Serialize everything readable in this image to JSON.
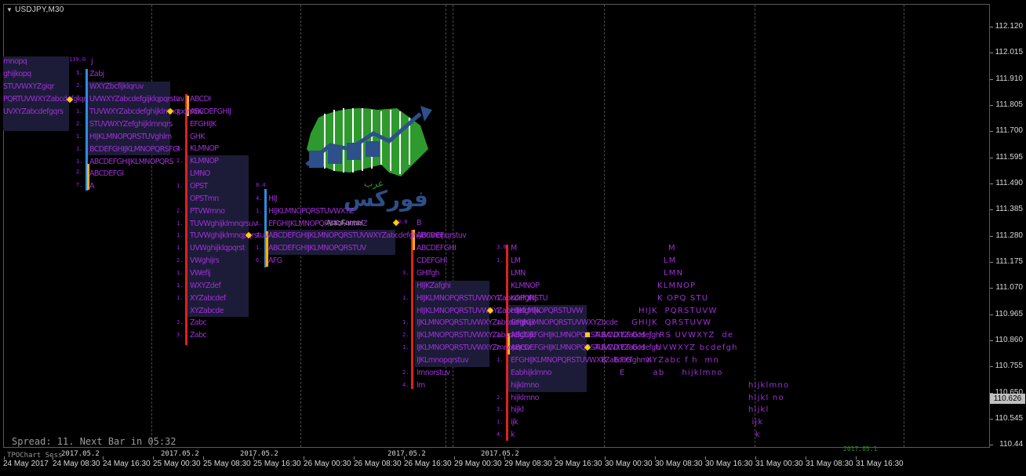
{
  "chart": {
    "symbol_label": "USDJPY,M30",
    "spread_text": "Spread: 11. Next Bar in 05:32",
    "tpo_label": "TPOChart Sess",
    "current_price": "110.626",
    "bottom_stamp": "2017.05.1",
    "watermark_text": "ArabFunnel"
  },
  "y_axis": [
    "112.120",
    "112.015",
    "111.910",
    "111.805",
    "111.700",
    "111.595",
    "111.490",
    "111.385",
    "111.280",
    "111.175",
    "111.070",
    "110.965",
    "110.860",
    "110.755",
    "110.650",
    "110.545",
    "110.44"
  ],
  "x_axis": [
    "24 May 2017",
    "24 May 08:30",
    "24 May 16:30",
    "25 May 00:30",
    "25 May 08:30",
    "25 May 16:30",
    "26 May 00:30",
    "26 May 08:30",
    "26 May 16:30",
    "29 May 00:30",
    "29 May 08:30",
    "29 May 16:30",
    "30 May 00:30",
    "30 May 08:30",
    "30 May 16:30",
    "31 May 00:30",
    "31 May 08:30",
    "31 May 16:30"
  ],
  "date_overlays": [
    "2017.05.2",
    "2017.05.2",
    "2017.05.2",
    "2017.05.2",
    "2017.05.2"
  ],
  "profiles": {
    "p1": {
      "rows": [
        "mnopq",
        "ghijkopq",
        "STUVWXYZgiqr",
        "PQRTUVWXYZabcdefgiqr",
        "UVXYZabcdefgqrs"
      ],
      "nums": [
        "139.0",
        "1.",
        "2.",
        "2.",
        "1."
      ]
    },
    "p2": {
      "rows": [
        "j",
        "Zabj",
        "WXYZbcfijklqruv",
        "UVWXYZabcdefgijklqpqrstuv",
        "TUVWXYZabcdefghijklmnqpqrstuv",
        "STUVWXYZefghijklmnqrs",
        "HIJKLMNOPQRSTUVghlm",
        "BCDEFGHIJKLMNOPQRSFGI",
        "ABCDEFGHIJKLMNOPQRS",
        "ABCDEFGI",
        "A"
      ],
      "nums": [
        "1.",
        "2.",
        "1.",
        "1.",
        "1.",
        "2.",
        "7."
      ]
    },
    "p3": {
      "rows": [
        "ABCDI",
        "ABCDEFGHIJ",
        "EFGHIJK",
        "GHK",
        "KLMNOP",
        "KLMNOP",
        "LMNO",
        "OPST",
        "OPSTmn",
        "PTVWmno",
        "TUVWghijklmnqrsuv",
        "TUVWghijklmnqpqrstuv",
        "UVWghijklqpqrst",
        "VWghijrs",
        "VWefij",
        "WXYZdef",
        "XYZabcdef",
        "XYZabcde",
        "Zabc",
        "Zabc"
      ],
      "nums": [
        "2.",
        "1.",
        "1.",
        "2.",
        "1.",
        "2.",
        "1.",
        "1.",
        "1.",
        "2.",
        "1.",
        "1.",
        "1.",
        "3.",
        "3."
      ]
    },
    "p4": {
      "rows": [
        "HIJ",
        "HIJKLMNOPQRSTUVWXYZ",
        "EFGHIJKLMNOPQRSTUVWXYZ",
        "ABCDEFGHIJKLMNOPQRSTUVWXYZabcdefghijklmnopqrstuv",
        "ABCDEFGHIJKLMNOPQRSTUV",
        "AFG"
      ],
      "nums": [
        "8.4",
        "4.",
        "1.",
        "1.",
        "1.",
        "1.",
        "6."
      ]
    },
    "p5": {
      "rows": [
        "B",
        "ABCDEF",
        "ABCDEFGHI",
        "CDEFGHI",
        "GHIfgh",
        "HIJKZafghi",
        "HIJKLMNOPQRSTUVWXYZabcdefghij",
        "HIJKLMNOPQRSTUVWXYZabcdefghijk",
        "IJKLMNOPQRSTUVWXYZabcdefghijk",
        "IJKLMNOPQRSTUVWXYZabcdefghijk",
        "IJKLMNOPQRSTUVWXYZmnopqrsv",
        "IJKLmnopqrstuv",
        "lmnorstuv",
        "lm"
      ],
      "nums": [
        "9.0",
        "3.",
        "1.",
        "1.",
        "2.",
        "1.",
        "2.",
        "4."
      ]
    },
    "p6": {
      "rows": [
        "M",
        "LM",
        "LMN",
        "KLMNOP",
        "KOPQRSTU",
        "HIJKLMNOPQRSTUVW",
        "GHIJKLMNOPQRSTUVWXYZbcde",
        "ABCDEFGHIJKLMNOPQRSTUVWXYZabcdefgh",
        "ABCDEFGHIJKLMNOPQRSTUVWXYZabcdefgh",
        "EFGHIJKLMNOPQRSTUVWXYZabcdefghmn",
        "Eabhijklmno",
        "hijklmno",
        "hijklmno",
        "hijkl",
        "ijk",
        "k"
      ],
      "nums": [
        "3.0",
        "1.",
        "1.",
        "1.",
        "1.",
        "1.",
        "2.",
        "1.",
        "2.",
        "3.",
        "1.",
        "4."
      ]
    },
    "p7": {
      "rows": [
        "M",
        "LM",
        "LMN",
        "KLMNOP",
        "K OPQ STU",
        "HIJK  PQRSTUVW",
        "GHIJK  QRSTUVW",
        "ABCDEFGH J  RS UVWXYZ  de",
        "ABCDEFGH   UVWXYZ bcdefgh",
        "B  EFG    XYZabc f h  mn",
        "E        ab     hijklmno",
        "                hijklmno",
        "                hijkl no",
        "                hijkl",
        "                 ijk",
        "                  k"
      ]
    }
  }
}
